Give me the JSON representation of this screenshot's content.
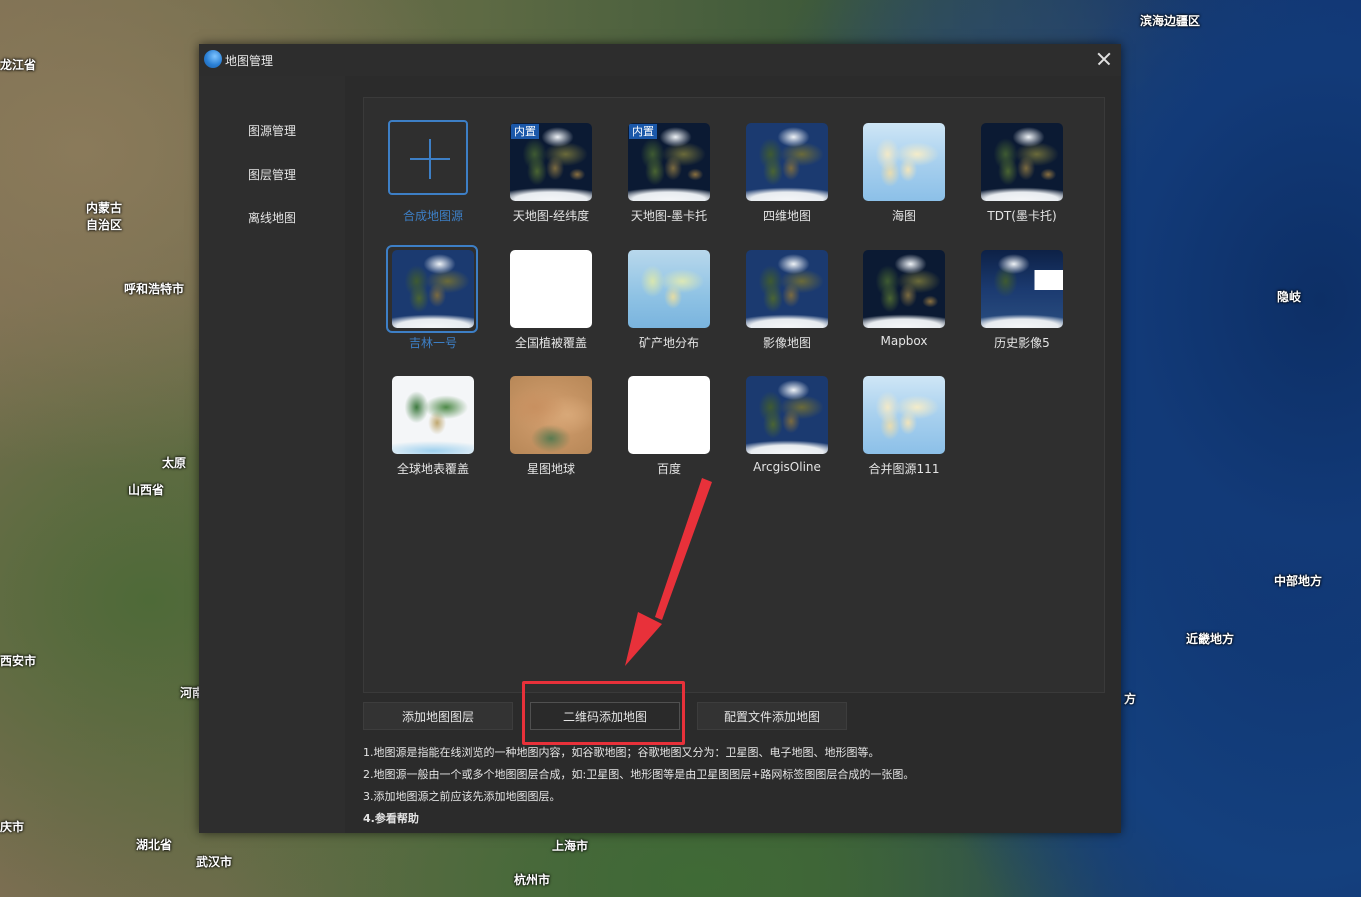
{
  "map_labels": [
    {
      "text": "滨海边疆区"
    },
    {
      "text": "龙江省"
    },
    {
      "text": "内蒙古\n自治区"
    },
    {
      "text": "呼和浩特市"
    },
    {
      "text": "太原"
    },
    {
      "text": "山西省"
    },
    {
      "text": "西安市"
    },
    {
      "text": "河南"
    },
    {
      "text": "湖北省"
    },
    {
      "text": "武汉市"
    },
    {
      "text": "庆市"
    },
    {
      "text": "上海市"
    },
    {
      "text": "杭州市"
    },
    {
      "text": "中部地方"
    },
    {
      "text": "近畿地方"
    },
    {
      "text": "方"
    },
    {
      "text": "隐岐"
    }
  ],
  "dialog": {
    "title": "地图管理",
    "sidebar": [
      "图源管理",
      "图层管理",
      "离线地图"
    ],
    "tiles": [
      {
        "label": "合成地图源",
        "kind": "add",
        "selected": false
      },
      {
        "label": "天地图-经纬度",
        "kind": "dark",
        "badge": "内置"
      },
      {
        "label": "天地图-墨卡托",
        "kind": "dark",
        "badge": "内置"
      },
      {
        "label": "四维地图",
        "kind": "blue"
      },
      {
        "label": "海图",
        "kind": "ocean"
      },
      {
        "label": "TDT(墨卡托)",
        "kind": "dark"
      },
      {
        "label": "吉林一号",
        "kind": "blue",
        "selected": true
      },
      {
        "label": "全国植被覆盖",
        "kind": "white"
      },
      {
        "label": "矿产地分布",
        "kind": "mineral"
      },
      {
        "label": "影像地图",
        "kind": "blue"
      },
      {
        "label": "Mapbox",
        "kind": "dark"
      },
      {
        "label": "历史影像5",
        "kind": "history"
      },
      {
        "label": "全球地表覆盖",
        "kind": "landcover"
      },
      {
        "label": "星图地球",
        "kind": "star"
      },
      {
        "label": "百度",
        "kind": "white"
      },
      {
        "label": "ArcgisOline",
        "kind": "blue"
      },
      {
        "label": "合并图源111",
        "kind": "ocean"
      }
    ],
    "buttons": {
      "add_layer": "添加地图图层",
      "qr_add": "二维码添加地图",
      "config_add": "配置文件添加地图"
    },
    "help": [
      "1.地图源是指能在线浏览的一种地图内容，如谷歌地图；谷歌地图又分为：卫星图、电子地图、地形图等。",
      "2.地图源一般由一个或多个地图图层合成，如:卫星图、地形图等是由卫星图图层+路网标签图图层合成的一张图。",
      "3.添加地图源之前应该先添加地图图层。",
      "4.参看帮助"
    ]
  },
  "colors": {
    "accent": "#3d7fc6",
    "highlight": "#e8313a",
    "dialog_bg": "#2b2b2b"
  }
}
